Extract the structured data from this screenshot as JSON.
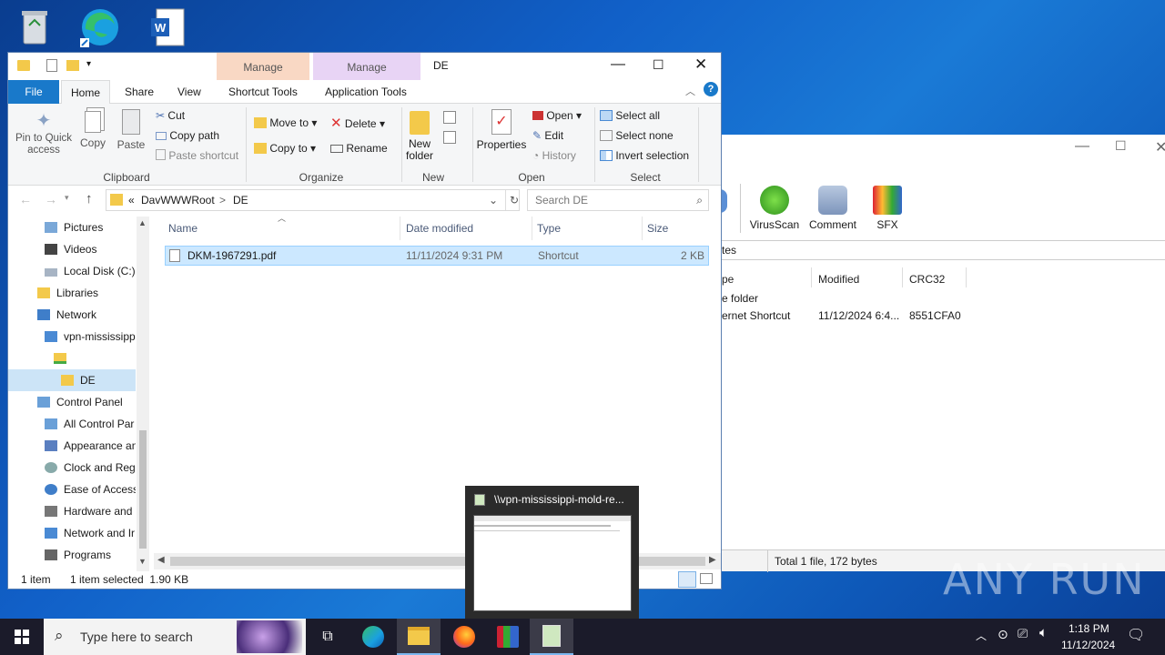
{
  "explorer": {
    "title": "DE",
    "ctx_tab_1": "Manage",
    "ctx_tab_2": "Manage",
    "tabs": [
      "File",
      "Home",
      "Share",
      "View",
      "Shortcut Tools",
      "Application Tools"
    ],
    "ribbon": {
      "pin": "Pin to Quick access",
      "copy": "Copy",
      "paste": "Paste",
      "cut": "Cut",
      "copy_path": "Copy path",
      "paste_shortcut": "Paste shortcut",
      "clipboard": "Clipboard",
      "move_to": "Move to",
      "copy_to": "Copy to",
      "delete": "Delete",
      "rename": "Rename",
      "organize": "Organize",
      "new_folder": "New folder",
      "new": "New",
      "properties": "Properties",
      "open_btn": "Open",
      "edit": "Edit",
      "history": "History",
      "open": "Open",
      "select_all": "Select all",
      "select_none": "Select none",
      "invert_selection": "Invert selection",
      "select": "Select"
    },
    "address": {
      "prefix": "«",
      "part1": "DavWWWRoot",
      "sep": ">",
      "part2": "DE"
    },
    "search_placeholder": "Search DE",
    "nav": [
      "Pictures",
      "Videos",
      "Local Disk (C:)",
      "Libraries",
      "Network",
      "vpn-mississipp",
      "",
      "DE",
      "Control Panel",
      "All Control Par",
      "Appearance an",
      "Clock and Regi",
      "Ease of Access",
      "Hardware and",
      "Network and Ir",
      "Programs"
    ],
    "columns": [
      "Name",
      "Date modified",
      "Type",
      "Size"
    ],
    "files": [
      {
        "name": "DKM-1967291.pdf",
        "date": "11/11/2024 9:31 PM",
        "type": "Shortcut",
        "size": "2 KB"
      }
    ],
    "status_items": "1 item",
    "status_selected": "1 item selected  1.90 KB"
  },
  "winrar": {
    "tools": [
      "VirusScan",
      "Comment",
      "SFX"
    ],
    "path_fragment": "tes",
    "columns": [
      "pe",
      "Modified",
      "CRC32"
    ],
    "rows": [
      {
        "type": "e folder",
        "modified": "",
        "crc": ""
      },
      {
        "type": "ernet Shortcut",
        "modified": "11/12/2024 6:4...",
        "crc": "8551CFA0"
      }
    ],
    "status": "Total 1 file, 172 bytes"
  },
  "thumbnail": {
    "title": "\\\\vpn-mississippi-mold-re..."
  },
  "taskbar": {
    "search_placeholder": "Type here to search",
    "time": "1:18 PM",
    "date": "11/12/2024"
  },
  "watermark": "ANY RUN"
}
